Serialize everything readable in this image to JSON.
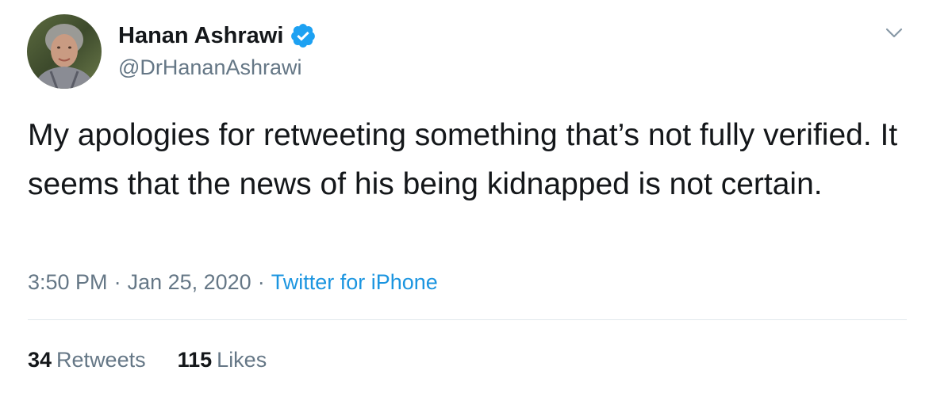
{
  "tweet": {
    "author": {
      "display_name": "Hanan Ashrawi",
      "handle": "@DrHananAshrawi",
      "verified": true
    },
    "text": "My apologies for retweeting something that’s not fully verified. It seems that the news of his being kidnapped is not certain.",
    "time": "3:50 PM",
    "separator": "·",
    "date": "Jan 25, 2020",
    "source": "Twitter for iPhone",
    "stats": {
      "retweets_count": "34",
      "retweets_label": "Retweets",
      "likes_count": "115",
      "likes_label": "Likes"
    }
  },
  "icons": {
    "verified": "verified-badge-icon",
    "menu": "chevron-down-icon"
  },
  "colors": {
    "text": "#14171a",
    "secondary": "#657786",
    "link": "#1b95e0",
    "verified": "#1da1f2",
    "divider": "#e1e8ed"
  }
}
